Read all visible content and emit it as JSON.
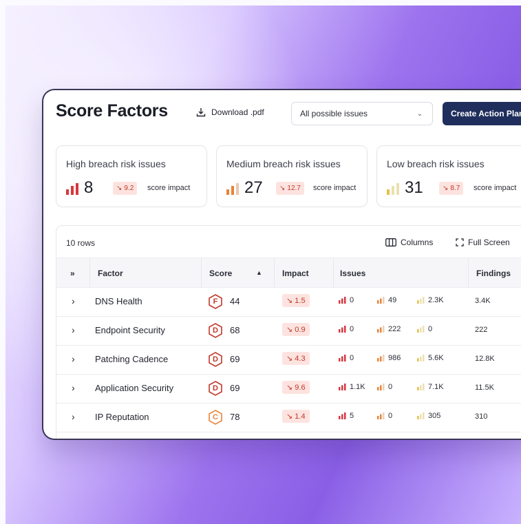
{
  "header": {
    "title": "Score Factors",
    "download_label": "Download .pdf",
    "filter_value": "All possible issues",
    "cta_label": "Create Action Plan"
  },
  "cards": [
    {
      "label": "High breach risk issues",
      "count": "8",
      "impact": "9.2",
      "impact_suffix": "score impact",
      "color": "#d9363e"
    },
    {
      "label": "Medium breach risk issues",
      "count": "27",
      "impact": "12.7",
      "impact_suffix": "score impact",
      "color": "#e8843a"
    },
    {
      "label": "Low breach risk issues",
      "count": "31",
      "impact": "8.7",
      "impact_suffix": "score impact",
      "color": "#e3c14a"
    }
  ],
  "table": {
    "rows_label": "10 rows",
    "columns_button": "Columns",
    "fullscreen_button": "Full Screen",
    "headers": {
      "expand": "»",
      "factor": "Factor",
      "score": "Score",
      "sort_indicator": "▲",
      "impact": "Impact",
      "issues": "Issues",
      "findings": "Findings"
    },
    "rows": [
      {
        "factor": "DNS Health",
        "grade": "F",
        "score": "44",
        "impact": "1.5",
        "high": "0",
        "medium": "49",
        "low": "2.3K",
        "findings": "3.4K"
      },
      {
        "factor": "Endpoint Security",
        "grade": "D",
        "score": "68",
        "impact": "0.9",
        "high": "0",
        "medium": "222",
        "low": "0",
        "findings": "222"
      },
      {
        "factor": "Patching Cadence",
        "grade": "D",
        "score": "69",
        "impact": "4.3",
        "high": "0",
        "medium": "986",
        "low": "5.6K",
        "findings": "12.8K"
      },
      {
        "factor": "Application Security",
        "grade": "D",
        "score": "69",
        "impact": "9.6",
        "high": "1.1K",
        "medium": "0",
        "low": "7.1K",
        "findings": "11.5K"
      },
      {
        "factor": "IP Reputation",
        "grade": "C",
        "score": "78",
        "impact": "1.4",
        "high": "5",
        "medium": "0",
        "low": "305",
        "findings": "310"
      }
    ]
  },
  "colors": {
    "grade_F": "#c0392b",
    "grade_D": "#c0392b",
    "grade_C": "#e8843a",
    "cta": "#1f2e5c",
    "impact_chip_bg": "#fde3df"
  }
}
